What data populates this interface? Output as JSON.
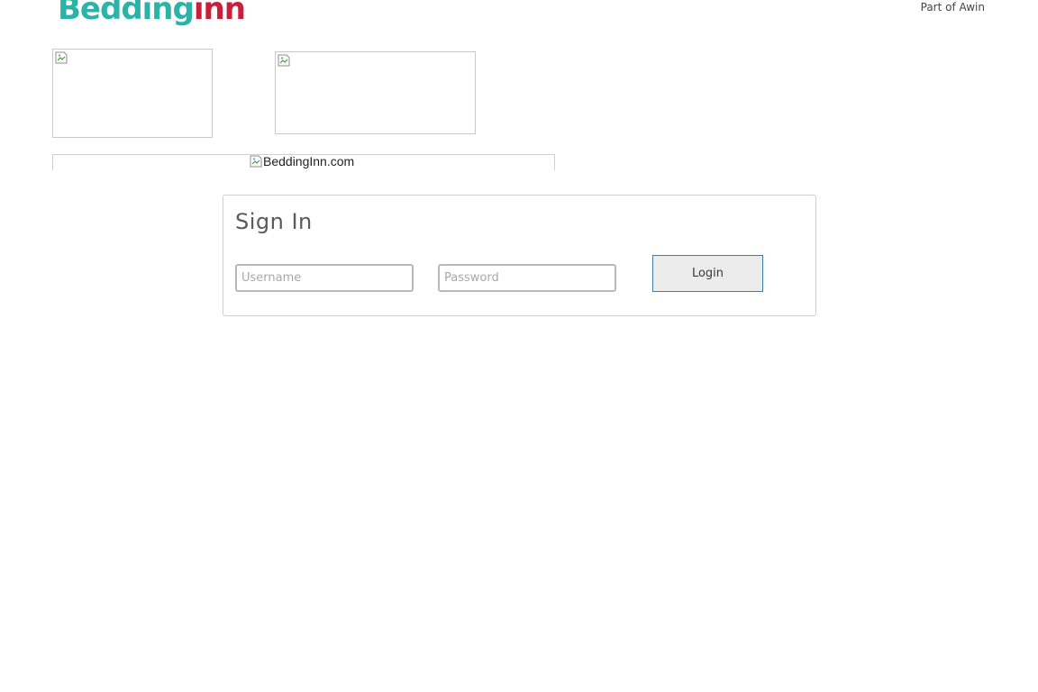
{
  "header": {
    "logo_part1": "Bedding",
    "logo_part2": "inn",
    "tagline": "Part of Awin"
  },
  "images": {
    "banner_alt": "BeddingInn.com"
  },
  "signin": {
    "title": "Sign In",
    "username_placeholder": "Username",
    "username_value": "",
    "password_placeholder": "Password",
    "password_value": "",
    "login_label": "Login"
  },
  "colors": {
    "logo_teal": "#2bb3a8",
    "logo_red": "#c8203a",
    "button_border": "#3c7fa6"
  },
  "icons": {
    "broken_image": "broken-image-icon"
  }
}
